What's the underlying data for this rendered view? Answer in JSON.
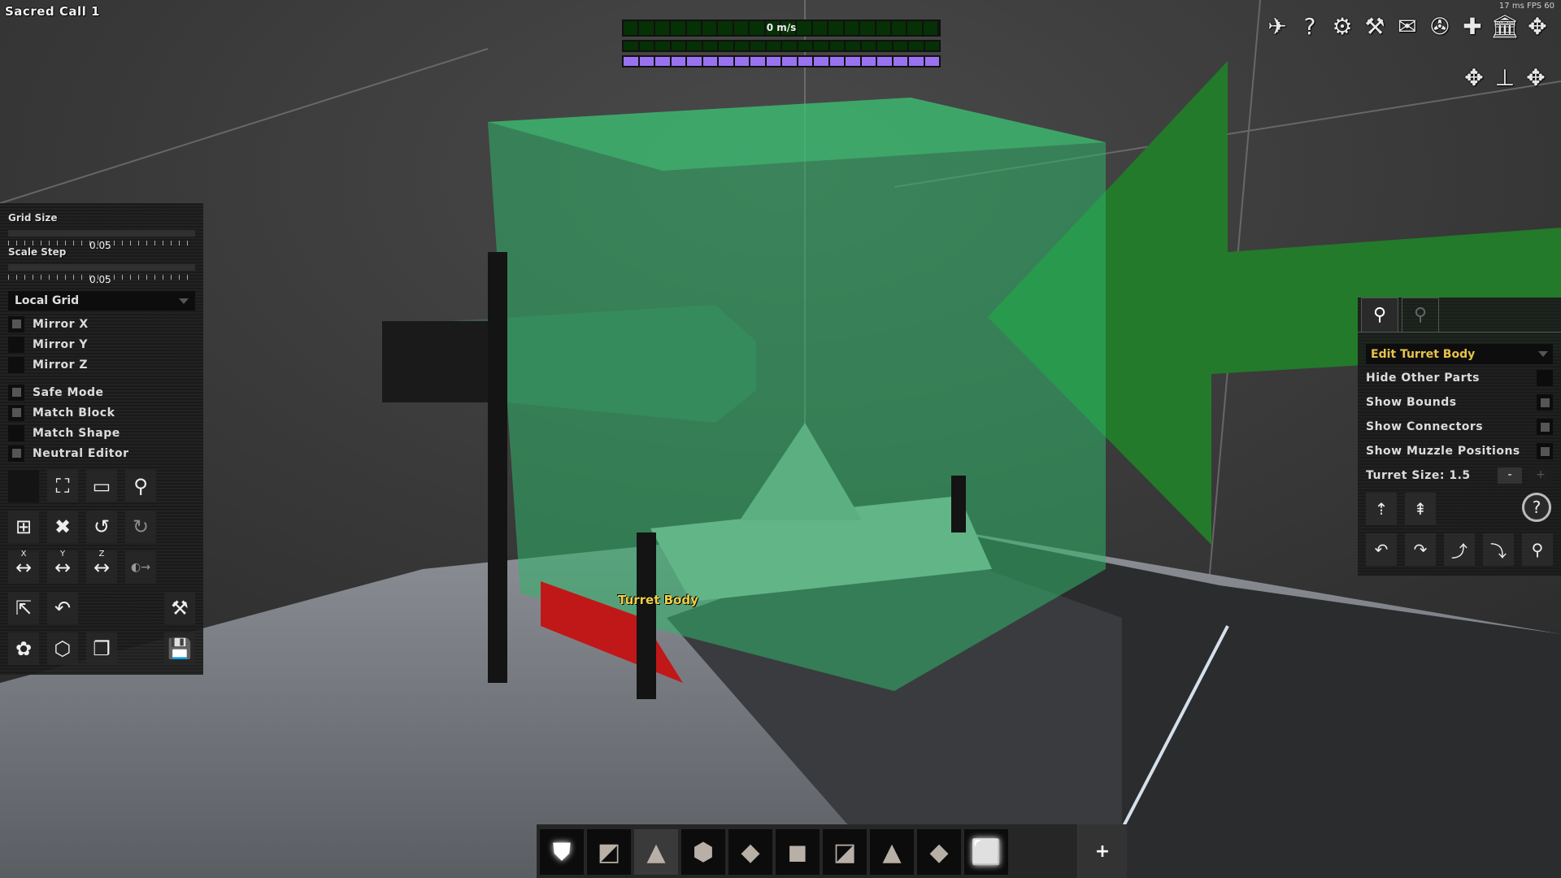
{
  "hud": {
    "ship_name": "Sacred Call 1",
    "speed_text": "0 m/s",
    "speed_fraction": 0,
    "power_fraction": 0,
    "shield_fraction": 1.0,
    "perf_text": "17 ms  FPS 60",
    "colors": {
      "speed_bar": "#063006",
      "shield_bar": "#9a72f0",
      "selection_box": "#2fb56a",
      "label_yellow": "#f0d04a"
    }
  },
  "top_icons": [
    {
      "name": "ship-icon",
      "glyph": "✈"
    },
    {
      "name": "help-icon",
      "glyph": "?"
    },
    {
      "name": "faction-icon",
      "glyph": "⚙"
    },
    {
      "name": "robot-arm-icon",
      "glyph": "⚒"
    },
    {
      "name": "mail-icon",
      "glyph": "✉"
    },
    {
      "name": "navigation-icon",
      "glyph": "✇"
    },
    {
      "name": "fleet-icon",
      "glyph": "✚"
    },
    {
      "name": "shop-icon",
      "glyph": "🏛"
    },
    {
      "name": "settings-puzzle-icon",
      "glyph": "✥"
    }
  ],
  "top_icons_row2": [
    {
      "name": "puzzle-left-icon",
      "glyph": "✥"
    },
    {
      "name": "connector-icon",
      "glyph": "⊥"
    },
    {
      "name": "puzzle-right-icon",
      "glyph": "✥"
    }
  ],
  "left_panel": {
    "grid_size_label": "Grid Size",
    "grid_size_value": "0.05",
    "scale_step_label": "Scale Step",
    "scale_step_value": "0.05",
    "grid_mode": "Local Grid",
    "checkboxes": [
      {
        "label": "Mirror X",
        "checked": true
      },
      {
        "label": "Mirror Y",
        "checked": false
      },
      {
        "label": "Mirror Z",
        "checked": false
      },
      {
        "label": "Safe Mode",
        "checked": true
      },
      {
        "label": "Match Block",
        "checked": true
      },
      {
        "label": "Match Shape",
        "checked": false
      },
      {
        "label": "Neutral Editor",
        "checked": true
      }
    ],
    "tools": [
      {
        "name": "empty-slot-icon",
        "glyph": ""
      },
      {
        "name": "selection-corners-icon",
        "glyph": "⛶"
      },
      {
        "name": "select-box-icon",
        "glyph": "▭"
      },
      {
        "name": "connect-icon",
        "glyph": "⚲"
      },
      {
        "name": "merge-icon",
        "glyph": "⊞"
      },
      {
        "name": "remove-icon",
        "glyph": "✖"
      },
      {
        "name": "undo-icon",
        "glyph": "↺"
      },
      {
        "name": "redo-icon",
        "glyph": "↻"
      },
      {
        "name": "mirror-x-icon",
        "glyph": "↔",
        "sub": "X"
      },
      {
        "name": "mirror-y-icon",
        "glyph": "↔",
        "sub": "Y"
      },
      {
        "name": "mirror-z-icon",
        "glyph": "↔",
        "sub": "Z"
      },
      {
        "name": "view-icon",
        "glyph": "◐→"
      },
      {
        "name": "scale-icon",
        "glyph": "⇱"
      },
      {
        "name": "rotate-icon",
        "glyph": "↶"
      },
      {
        "name": "robot-arm-icon",
        "glyph": "⚒"
      },
      {
        "name": "paint-icon",
        "glyph": "✿"
      },
      {
        "name": "blocks-icon",
        "glyph": "⬡"
      },
      {
        "name": "block-list-icon",
        "glyph": "❐"
      },
      {
        "name": "save-icon",
        "glyph": "💾"
      }
    ]
  },
  "viewport": {
    "selection_label": "Turret Body"
  },
  "right_panel": {
    "tabs": [
      {
        "name": "turret-body-tab",
        "glyph": "⚲",
        "active": true
      },
      {
        "name": "turret-barrel-tab",
        "glyph": "⚲",
        "active": false
      }
    ],
    "mode": "Edit Turret Body",
    "options": [
      {
        "label": "Hide Other Parts",
        "checked": false
      },
      {
        "label": "Show Bounds",
        "checked": true
      },
      {
        "label": "Show Connectors",
        "checked": true
      },
      {
        "label": "Show Muzzle Positions",
        "checked": true
      }
    ],
    "turret_size_label": "Turret Size: 1.5",
    "minus_label": "-",
    "plus_label": "+",
    "buttons": [
      {
        "name": "move-down-icon",
        "glyph": "⇡"
      },
      {
        "name": "move-up-icon",
        "glyph": "⇞"
      },
      {
        "name": "help-icon",
        "glyph": "?"
      },
      {
        "name": "rotate-y-left-icon",
        "glyph": "↶"
      },
      {
        "name": "rotate-y-right-icon",
        "glyph": "↷"
      },
      {
        "name": "rotate-x-up-icon",
        "glyph": "⤴"
      },
      {
        "name": "rotate-x-down-icon",
        "glyph": "⤵"
      },
      {
        "name": "turret-icon",
        "glyph": "⚲"
      }
    ]
  },
  "hotbar": {
    "slots": [
      {
        "name": "shield-block-icon",
        "glyph": "⛊",
        "selected": false,
        "white": true
      },
      {
        "name": "wedge-block-icon",
        "glyph": "◩",
        "selected": false,
        "white": false
      },
      {
        "name": "tetra-block-icon",
        "glyph": "▲",
        "selected": true,
        "white": false
      },
      {
        "name": "cube-corner-block-icon",
        "glyph": "⬢",
        "selected": false,
        "white": false
      },
      {
        "name": "spike-block-icon",
        "glyph": "◆",
        "selected": false,
        "white": false
      },
      {
        "name": "cube-block-icon",
        "glyph": "◼",
        "selected": false,
        "white": false
      },
      {
        "name": "slope-block-icon",
        "glyph": "◪",
        "selected": false,
        "white": false
      },
      {
        "name": "small-tetra-block-icon",
        "glyph": "▲",
        "selected": false,
        "white": false
      },
      {
        "name": "crystal-block-icon",
        "glyph": "◆",
        "selected": false,
        "white": false
      },
      {
        "name": "light-block-icon",
        "glyph": "⬜",
        "selected": false,
        "white": true
      }
    ],
    "add_label": "+"
  }
}
